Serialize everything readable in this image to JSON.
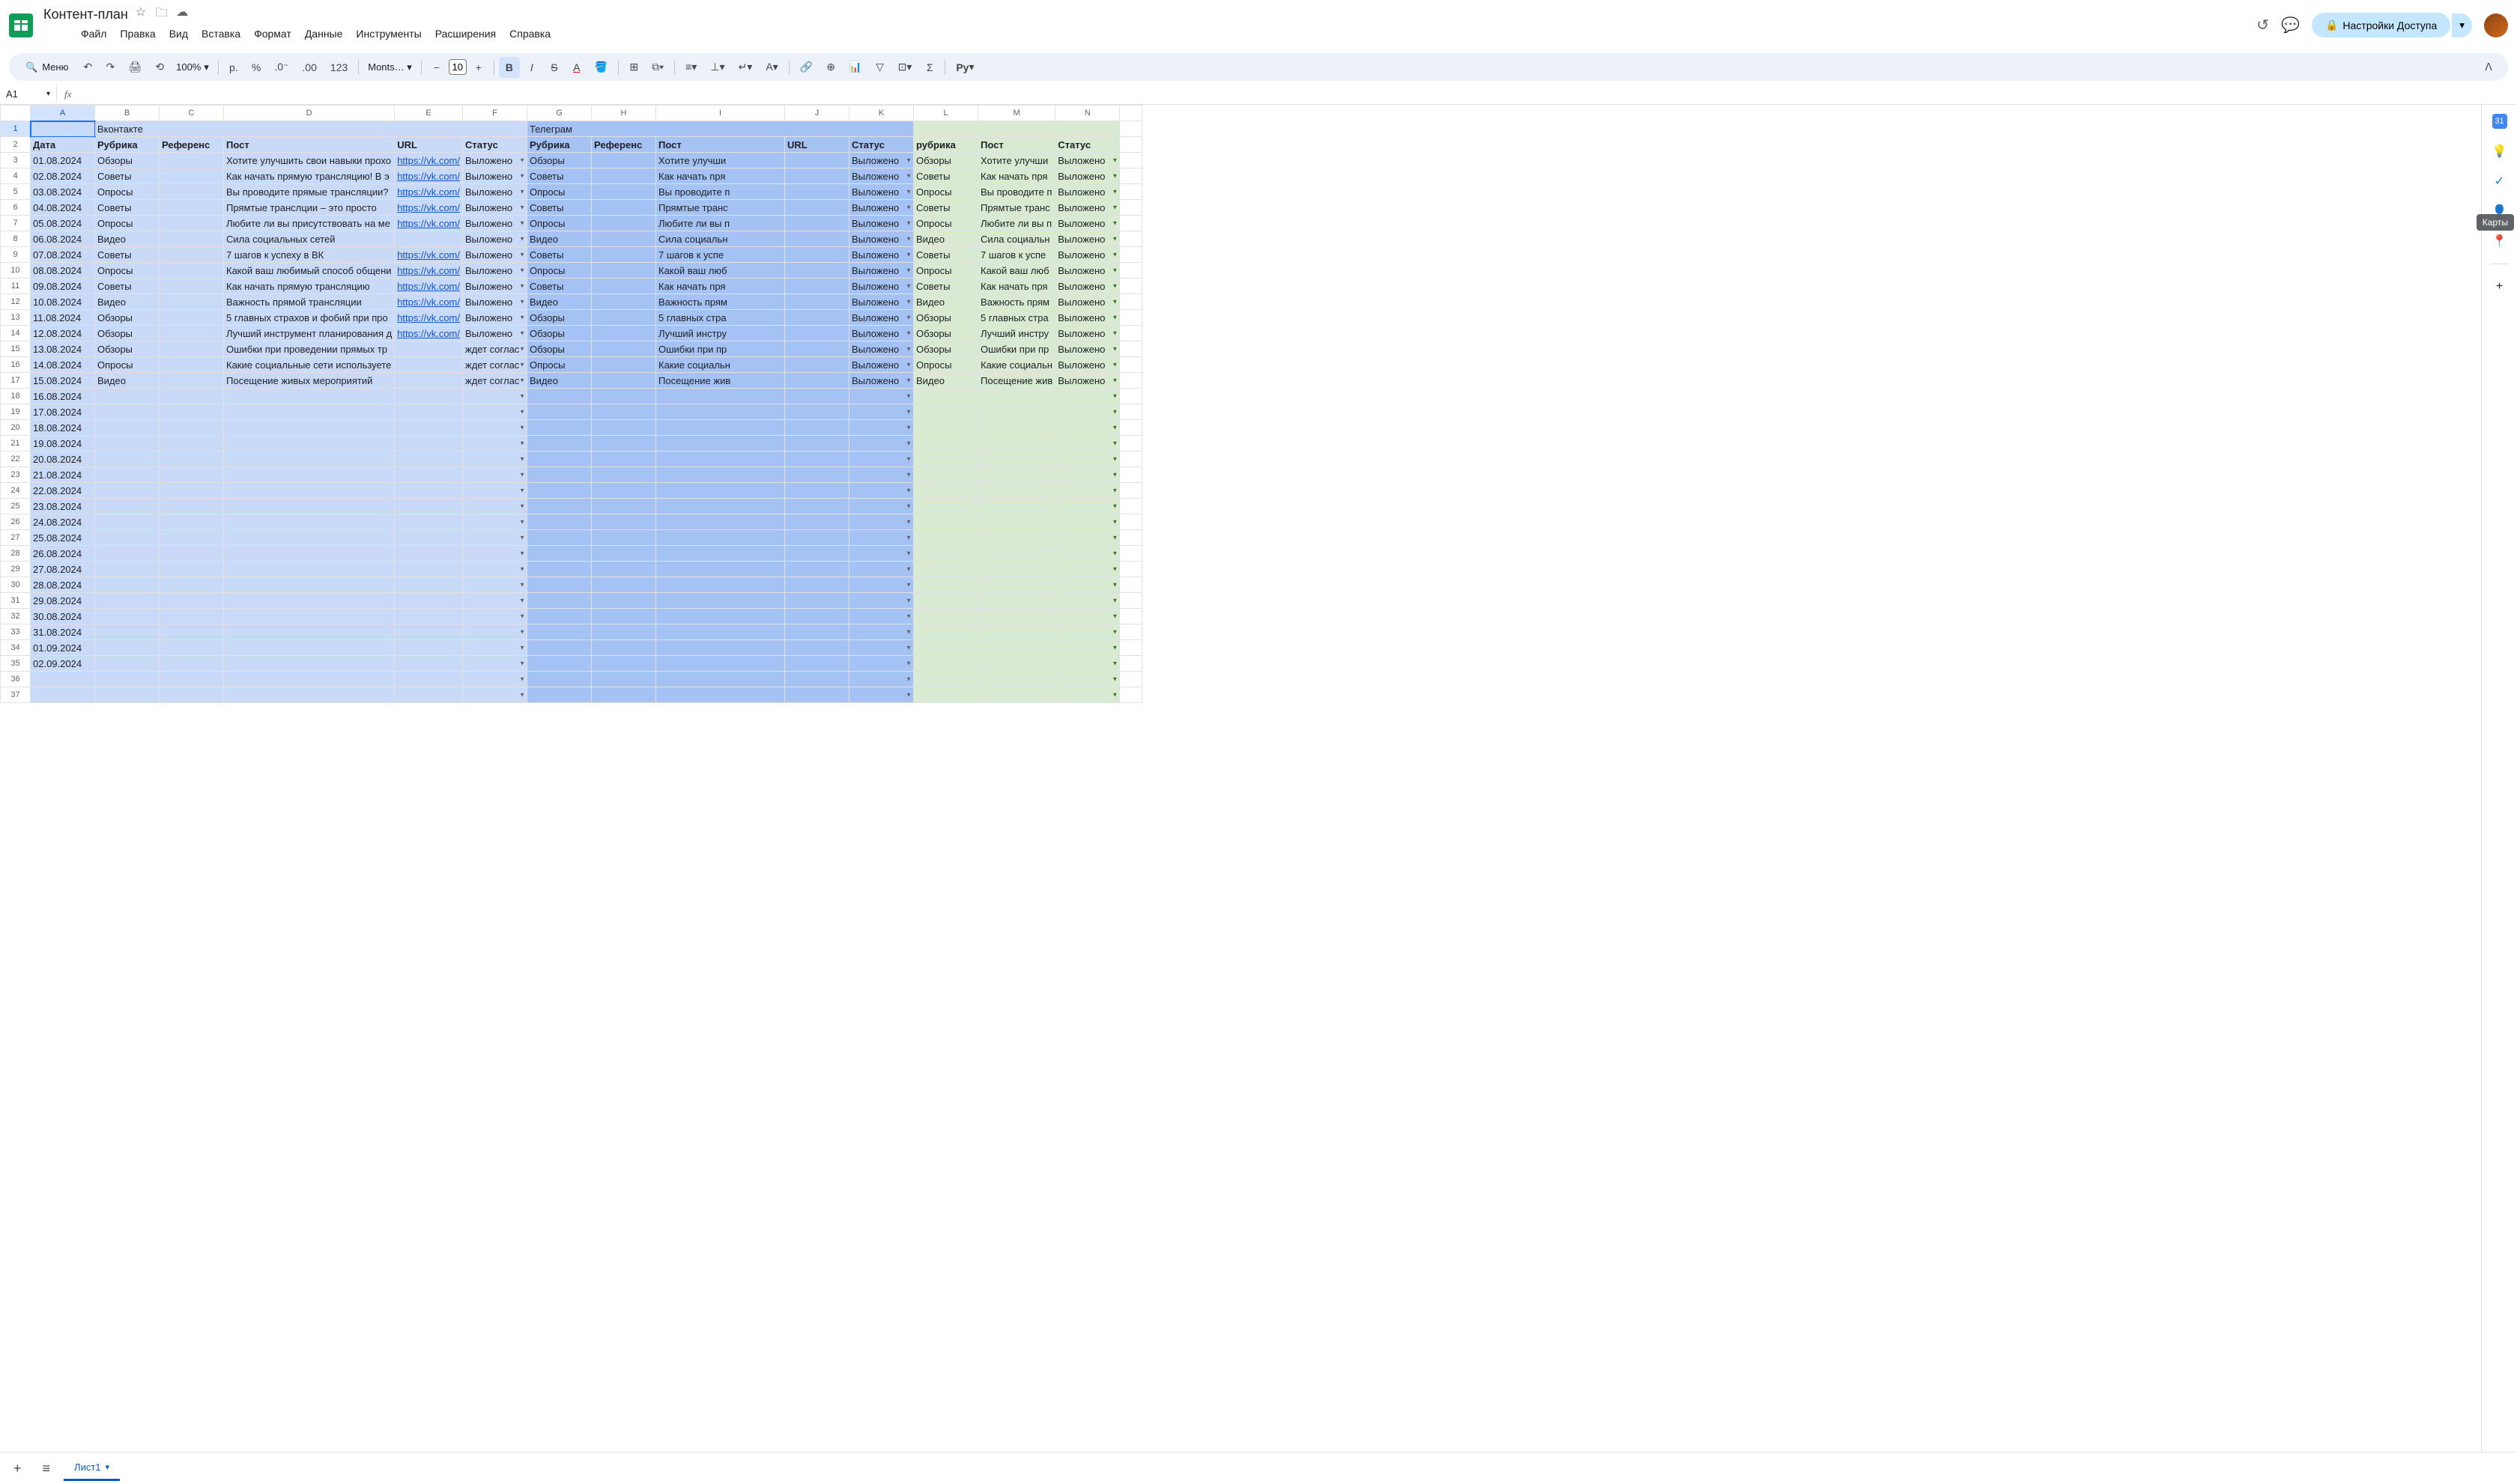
{
  "doc": {
    "title": "Контент-план"
  },
  "menus": [
    "Файл",
    "Правка",
    "Вид",
    "Вставка",
    "Формат",
    "Данные",
    "Инструменты",
    "Расширения",
    "Справка"
  ],
  "toolbar": {
    "search_label": "Меню",
    "zoom": "100%",
    "currency": "р.",
    "percent": "%",
    "num": "123",
    "font": "Monts…",
    "font_size": "10"
  },
  "share": {
    "label": "Настройки Доступа"
  },
  "namebox": "A1",
  "cols": [
    "A",
    "B",
    "C",
    "D",
    "E",
    "F",
    "G",
    "H",
    "I",
    "J",
    "K",
    "L",
    "M",
    "N",
    ""
  ],
  "sections": {
    "vk": "Вконтакте",
    "tg": "Телеграм"
  },
  "headers": {
    "date": "Дата",
    "rubric": "Рубрика",
    "ref": "Референс",
    "post": "Пост",
    "url": "URL",
    "status": "Статус",
    "rubric2": "рубрика"
  },
  "link_text": "https://vk.com/",
  "status_posted": "Выложено",
  "status_wait": "ждет соглас",
  "rows": [
    {
      "n": 3,
      "date": "01.08.2024",
      "rubric": "Обзоры",
      "post": "Хотите улучшить свои навыки прохо",
      "url": true,
      "st": "Выложено",
      "tg_rubric": "Обзоры",
      "tg_post": "Хотите улучши",
      "tg_st": "Выложено",
      "g_rub": "Обзоры",
      "g_post": "Хотите улучши",
      "g_st": "Выложено"
    },
    {
      "n": 4,
      "date": "02.08.2024",
      "rubric": "Советы",
      "post": "Как начать прямую трансляцию! В э",
      "url": true,
      "st": "Выложено",
      "tg_rubric": "Советы",
      "tg_post": "Как начать пря",
      "tg_st": "Выложено",
      "g_rub": "Советы",
      "g_post": "Как начать пря",
      "g_st": "Выложено"
    },
    {
      "n": 5,
      "date": "03.08.2024",
      "rubric": "Опросы",
      "post": "Вы проводите прямые трансляции?",
      "url": true,
      "st": "Выложено",
      "tg_rubric": "Опросы",
      "tg_post": "Вы проводите п",
      "tg_st": "Выложено",
      "g_rub": "Опросы",
      "g_post": "Вы проводите п",
      "g_st": "Выложено"
    },
    {
      "n": 6,
      "date": "04.08.2024",
      "rubric": "Советы",
      "post": "Прямтые транслции – это просто",
      "url": true,
      "st": "Выложено",
      "tg_rubric": "Советы",
      "tg_post": "Прямтые транс",
      "tg_st": "Выложено",
      "g_rub": "Советы",
      "g_post": "Прямтые транс",
      "g_st": "Выложено"
    },
    {
      "n": 7,
      "date": "05.08.2024",
      "rubric": "Опросы",
      "post": "Любите ли вы присутствовать на ме",
      "url": true,
      "st": "Выложено",
      "tg_rubric": "Опросы",
      "tg_post": "Любите ли вы п",
      "tg_st": "Выложено",
      "g_rub": "Опросы",
      "g_post": "Любите ли вы п",
      "g_st": "Выложено"
    },
    {
      "n": 8,
      "date": "06.08.2024",
      "rubric": "Видео",
      "post": "Сила социальных сетей",
      "url": false,
      "st": "Выложено",
      "tg_rubric": "Видео",
      "tg_post": "Сила социальн",
      "tg_st": "Выложено",
      "g_rub": "Видео",
      "g_post": "Сила социальн",
      "g_st": "Выложено"
    },
    {
      "n": 9,
      "date": "07.08.2024",
      "rubric": "Советы",
      "post": "7 шагов к успеху в ВК",
      "url": true,
      "st": "Выложено",
      "tg_rubric": "Советы",
      "tg_post": "7 шагов к успе",
      "tg_st": "Выложено",
      "g_rub": "Советы",
      "g_post": "7 шагов к успе",
      "g_st": "Выложено"
    },
    {
      "n": 10,
      "date": "08.08.2024",
      "rubric": "Опросы",
      "post": "Какой ваш любимый способ общени",
      "url": true,
      "st": "Выложено",
      "tg_rubric": "Опросы",
      "tg_post": "Какой ваш люб",
      "tg_st": "Выложено",
      "g_rub": "Опросы",
      "g_post": "Какой ваш люб",
      "g_st": "Выложено"
    },
    {
      "n": 11,
      "date": "09.08.2024",
      "rubric": "Советы",
      "post": "Как начать прямую трансляцию",
      "url": true,
      "st": "Выложено",
      "tg_rubric": "Советы",
      "tg_post": "Как начать пря",
      "tg_st": "Выложено",
      "g_rub": "Советы",
      "g_post": "Как начать пря",
      "g_st": "Выложено"
    },
    {
      "n": 12,
      "date": "10.08.2024",
      "rubric": "Видео",
      "post": "Важность прямой трансляции",
      "url": true,
      "st": "Выложено",
      "tg_rubric": "Видео",
      "tg_post": "Важность прям",
      "tg_st": "Выложено",
      "g_rub": "Видео",
      "g_post": "Важность прям",
      "g_st": "Выложено"
    },
    {
      "n": 13,
      "date": "11.08.2024",
      "rubric": "Обзоры",
      "post": "5 главных страхов и фобий при про",
      "url": true,
      "st": "Выложено",
      "tg_rubric": "Обзоры",
      "tg_post": "5 главных стра",
      "tg_st": "Выложено",
      "g_rub": "Обзоры",
      "g_post": "5 главных стра",
      "g_st": "Выложено"
    },
    {
      "n": 14,
      "date": "12.08.2024",
      "rubric": "Обзоры",
      "post": "Лучший инструмент планирования д",
      "url": true,
      "st": "Выложено",
      "tg_rubric": "Обзоры",
      "tg_post": "Лучший инстру",
      "tg_st": "Выложено",
      "g_rub": "Обзоры",
      "g_post": "Лучший инстру",
      "g_st": "Выложено"
    },
    {
      "n": 15,
      "date": "13.08.2024",
      "rubric": "Обзоры",
      "post": "Ошибки при проведении прямых тр",
      "url": false,
      "st": "ждет соглас",
      "tg_rubric": "Обзоры",
      "tg_post": "Ошибки при пр",
      "tg_st": "Выложено",
      "g_rub": "Обзоры",
      "g_post": "Ошибки при пр",
      "g_st": "Выложено"
    },
    {
      "n": 16,
      "date": "14.08.2024",
      "rubric": "Опросы",
      "post": "Какие социальные сети используете",
      "url": false,
      "st": "ждет соглас",
      "tg_rubric": "Опросы",
      "tg_post": "Какие социальн",
      "tg_st": "Выложено",
      "g_rub": "Опросы",
      "g_post": "Какие социальн",
      "g_st": "Выложено"
    },
    {
      "n": 17,
      "date": "15.08.2024",
      "rubric": "Видео",
      "post": "Посещение живых мероприятий",
      "url": false,
      "st": "ждет соглас",
      "tg_rubric": "Видео",
      "tg_post": "Посещение жив",
      "tg_st": "Выложено",
      "g_rub": "Видео",
      "g_post": "Посещение жив",
      "g_st": "Выложено"
    }
  ],
  "empty_dates": [
    {
      "n": 18,
      "date": "16.08.2024"
    },
    {
      "n": 19,
      "date": "17.08.2024"
    },
    {
      "n": 20,
      "date": "18.08.2024"
    },
    {
      "n": 21,
      "date": "19.08.2024"
    },
    {
      "n": 22,
      "date": "20.08.2024"
    },
    {
      "n": 23,
      "date": "21.08.2024"
    },
    {
      "n": 24,
      "date": "22.08.2024"
    },
    {
      "n": 25,
      "date": "23.08.2024"
    },
    {
      "n": 26,
      "date": "24.08.2024"
    },
    {
      "n": 27,
      "date": "25.08.2024"
    },
    {
      "n": 28,
      "date": "26.08.2024"
    },
    {
      "n": 29,
      "date": "27.08.2024"
    },
    {
      "n": 30,
      "date": "28.08.2024"
    },
    {
      "n": 31,
      "date": "29.08.2024"
    },
    {
      "n": 32,
      "date": "30.08.2024"
    },
    {
      "n": 33,
      "date": "31.08.2024"
    },
    {
      "n": 34,
      "date": "01.09.2024"
    },
    {
      "n": 35,
      "date": "02.09.2024"
    },
    {
      "n": 36,
      "date": ""
    },
    {
      "n": 37,
      "date": ""
    }
  ],
  "sheet_tab": "Лист1",
  "tooltip": "Карты"
}
